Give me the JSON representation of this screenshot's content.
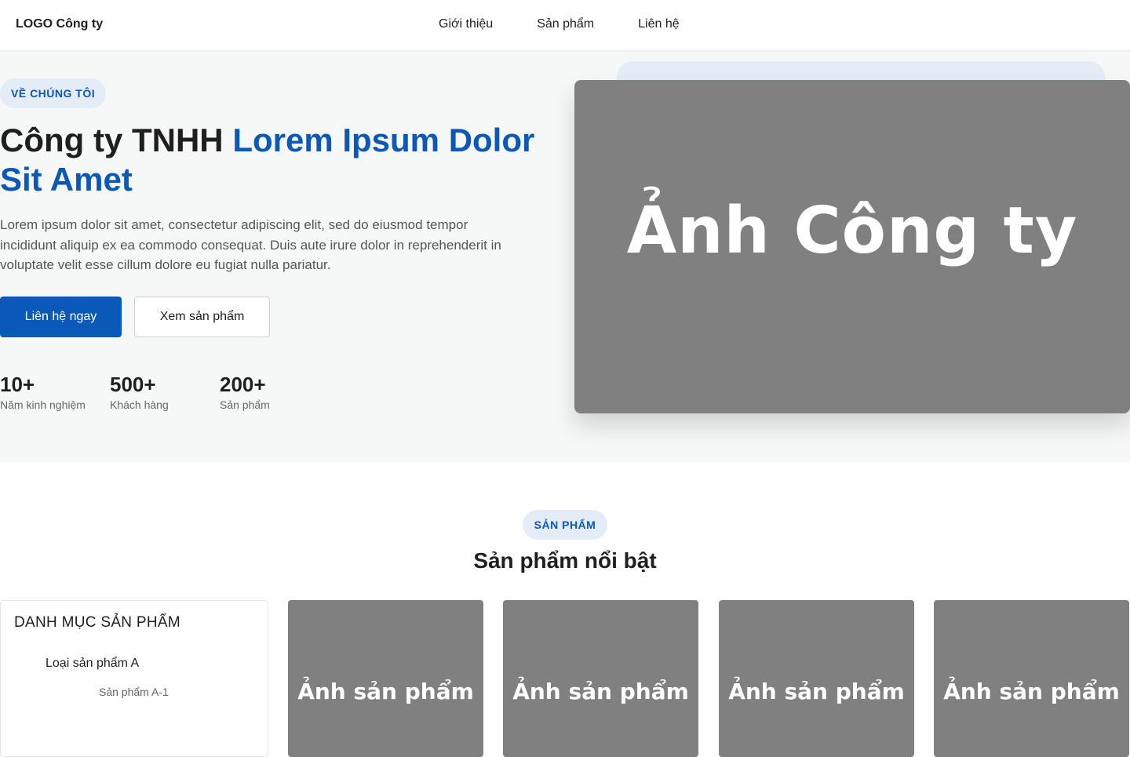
{
  "header": {
    "logo": "LOGO Công ty",
    "nav": [
      "Giới thiệu",
      "Sản phẩm",
      "Liên hệ"
    ]
  },
  "hero": {
    "badge": "VỀ CHÚNG TÔI",
    "title_plain": "Công ty TNHH",
    "title_accent": "Lorem Ipsum Dolor Sit Amet",
    "description": "Lorem ipsum dolor sit amet, consectetur adipiscing elit, sed do eiusmod tempor incididunt aliquip ex ea commodo consequat. Duis aute irure dolor in reprehenderit in voluptate velit esse cillum dolore eu fugiat nulla pariatur.",
    "primary_button": "Liên hệ ngay",
    "secondary_button": "Xem sản phẩm",
    "stats": [
      {
        "value": "10+",
        "label": "Năm kinh nghiệm"
      },
      {
        "value": "500+",
        "label": "Khách hàng"
      },
      {
        "value": "200+",
        "label": "Sản phẩm"
      }
    ],
    "image_label": "Ảnh Công ty"
  },
  "products": {
    "badge": "SẢN PHẨM",
    "title": "Sản phẩm nổi bật",
    "category_panel": {
      "title": "DANH MỤC SẢN PHẨM",
      "item": "Loại sản phẩm A",
      "subitem": "Sản phẩm A-1"
    },
    "cards": [
      "Ảnh sản phẩm",
      "Ảnh sản phẩm",
      "Ảnh sản phẩm",
      "Ảnh sản phẩm"
    ]
  },
  "colors": {
    "accent": "#0a58b8",
    "badge_bg": "#e3ecf7",
    "placeholder": "#808080"
  }
}
